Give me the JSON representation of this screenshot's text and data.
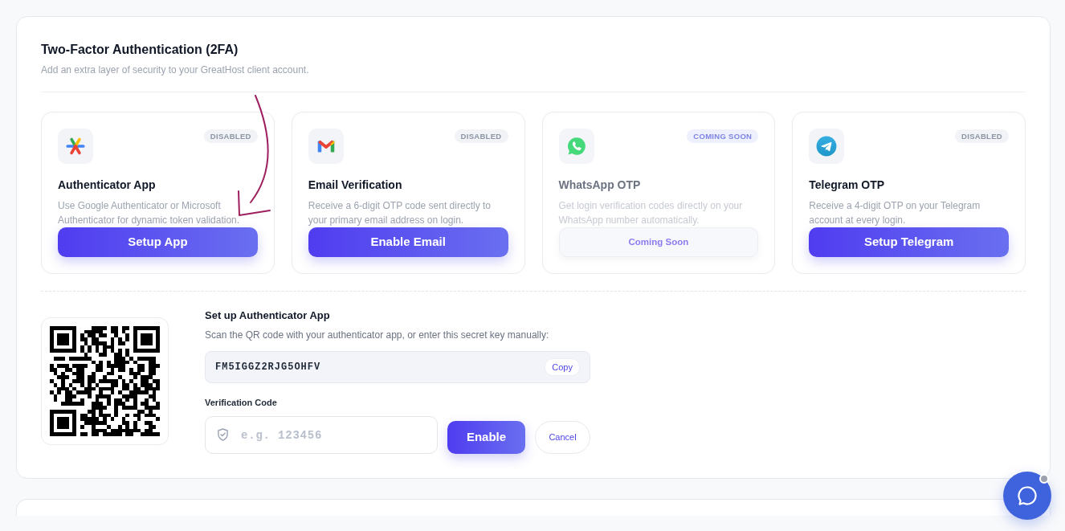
{
  "header": {
    "title": "Two-Factor Authentication (2FA)",
    "subtitle": "Add an extra layer of security to your GreatHost client account."
  },
  "methods": [
    {
      "kind": "authenticator",
      "badge": "DISABLED",
      "title": "Authenticator App",
      "description": "Use Google Authenticator or Microsoft Authenticator for dynamic token validation.",
      "button": "Setup App",
      "disabled": false
    },
    {
      "kind": "email",
      "badge": "DISABLED",
      "title": "Email Verification",
      "description": "Receive a 6-digit OTP code sent directly to your primary email address on login.",
      "button": "Enable Email",
      "disabled": false
    },
    {
      "kind": "whatsapp",
      "badge": "COMING SOON",
      "title": "WhatsApp OTP",
      "description": "Get login verification codes directly on your WhatsApp number automatically.",
      "button": "Coming Soon",
      "disabled": true
    },
    {
      "kind": "telegram",
      "badge": "DISABLED",
      "title": "Telegram OTP",
      "description": "Receive a 4-digit OTP on your Telegram account at every login.",
      "button": "Setup Telegram",
      "disabled": false
    }
  ],
  "setup": {
    "title": "Set up Authenticator App",
    "instructions": "Scan the QR code with your authenticator app, or enter this secret key manually:",
    "secret_key": "FM5IGGZ2RJG5OHFV",
    "copy_button": "Copy",
    "code_field": {
      "label": "Verification Code",
      "placeholder": "e.g. 123456"
    },
    "buttons": [
      {
        "kind": "primary",
        "label": "Enable"
      },
      {
        "kind": "secondary",
        "label": "Cancel"
      }
    ]
  }
}
